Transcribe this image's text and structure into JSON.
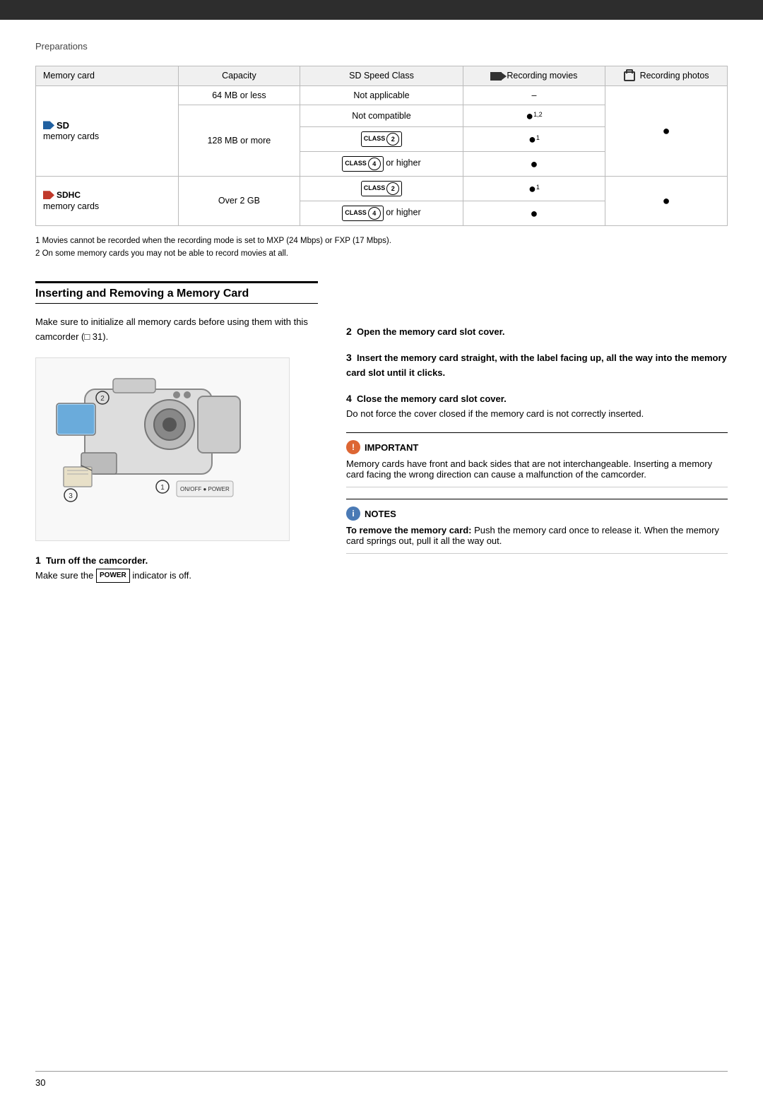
{
  "page": {
    "top_bar_color": "#2d2d2d",
    "breadcrumb": "Preparations",
    "page_number": "30"
  },
  "table": {
    "headers": {
      "memory_card": "Memory card",
      "capacity": "Capacity",
      "sd_speed_class": "SD Speed Class",
      "recording_movies": "Recording movies",
      "recording_photos": "Recording photos"
    },
    "rows": [
      {
        "card_type": "SD memory cards",
        "capacity_group": "64 MB or less",
        "speed_class": "Not applicable",
        "movies": "–",
        "photos": ""
      },
      {
        "card_type": "",
        "capacity_group": "128 MB or more",
        "speed_class": "Not compatible",
        "movies": "●1,2",
        "photos": ""
      },
      {
        "card_type": "",
        "capacity_group": "",
        "speed_class": "CLASS2",
        "movies": "●1",
        "photos": "●"
      },
      {
        "card_type": "",
        "capacity_group": "",
        "speed_class": "CLASS4 or higher",
        "movies": "●",
        "photos": ""
      },
      {
        "card_type": "SDHC memory cards",
        "capacity_group": "Over 2 GB",
        "speed_class": "CLASS2",
        "movies": "●1",
        "photos": ""
      },
      {
        "card_type": "",
        "capacity_group": "",
        "speed_class": "CLASS4 or higher",
        "movies": "●",
        "photos": ""
      }
    ],
    "footnotes": [
      "1  Movies cannot be recorded when the recording mode is set to MXP (24 Mbps) or FXP (17 Mbps).",
      "2  On some memory cards you may not be able to record movies at all."
    ]
  },
  "section": {
    "title": "Inserting and Removing a Memory Card",
    "intro": "Make sure to initialize all memory cards before using them with this camcorder (□ 31).",
    "steps": [
      {
        "number": "1",
        "title": "Turn off the camcorder.",
        "body": "Make sure the POWER indicator is off."
      },
      {
        "number": "2",
        "title": "Open the memory card slot cover.",
        "body": ""
      },
      {
        "number": "3",
        "title": "Insert the memory card straight, with the label facing up, all the way into the memory card slot until it clicks.",
        "body": ""
      },
      {
        "number": "4",
        "title": "Close the memory card slot cover.",
        "body": "Do not force the cover closed if the memory card is not correctly inserted."
      }
    ],
    "important": {
      "label": "IMPORTANT",
      "body": "Memory cards have front and back sides that are not interchangeable. Inserting a memory card facing the wrong direction can cause a malfunction of the camcorder."
    },
    "notes": {
      "label": "NOTES",
      "body_bold": "To remove the memory card:",
      "body": " Push the memory card once to release it. When the memory card springs out, pull it all the way out."
    }
  }
}
